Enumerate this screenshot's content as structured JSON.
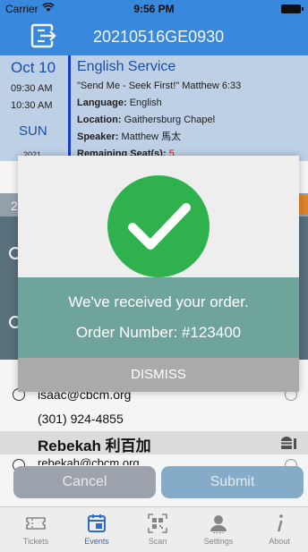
{
  "status_bar": {
    "carrier": "Carrier",
    "time": "9:56 PM"
  },
  "header": {
    "title": "20210516GE0930",
    "logout_icon": "logout-icon"
  },
  "event": {
    "date": "Oct 10",
    "time_start": "09:30 AM",
    "time_end": "10:30 AM",
    "day": "SUN",
    "year": "2021",
    "name": "English Service",
    "sermon": "\"Send Me - Seek First!\" Matthew 6:33",
    "language_label": "Language:",
    "language": "English",
    "location_label": "Location:",
    "location": "Gaithersburg Chapel",
    "speaker_label": "Speaker:",
    "speaker": "Matthew 馬太",
    "seats_label": "Remaining Seat(s):",
    "seats": "5"
  },
  "list": {
    "band_number": "2",
    "email": "isaac@cbcm.org",
    "phone": "(301) 924-4855",
    "person_name": "Rebekah 利百加",
    "person_email": "rebekah@cbcm.org"
  },
  "buttons": {
    "cancel": "Cancel",
    "submit": "Submit"
  },
  "tabs": [
    {
      "label": "Tickets",
      "icon": "ticket-icon"
    },
    {
      "label": "Events",
      "icon": "calendar-icon"
    },
    {
      "label": "Scan",
      "icon": "qr-code-icon"
    },
    {
      "label": "Settings",
      "icon": "person-icon"
    },
    {
      "label": "About",
      "icon": "info-icon"
    }
  ],
  "modal": {
    "message": "We've received your order.",
    "order_label": "Order Number: #123400",
    "dismiss": "DISMISS",
    "accent": "#2fb24e"
  }
}
